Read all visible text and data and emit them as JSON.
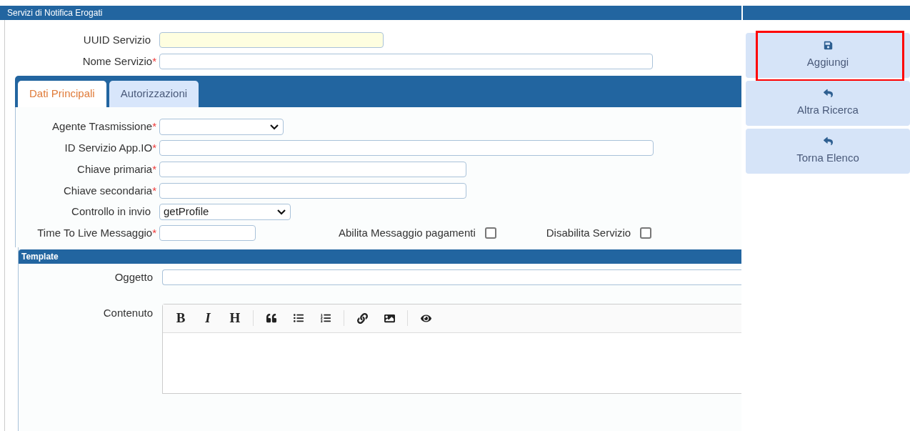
{
  "panel_title": "Servizi di Notifica Erogati",
  "top_fields": [
    {
      "label": "UUID Servizio",
      "kind": "readonly"
    },
    {
      "label": "Nome Servizio",
      "required_mark": "*",
      "kind": "text"
    }
  ],
  "tabs": [
    {
      "label": "Dati Principali",
      "selected": true
    },
    {
      "label": "Autorizzazioni",
      "selected": false
    }
  ],
  "tab_fields": [
    {
      "label": "Agente Trasmissione",
      "required_mark": "*",
      "kind": "select"
    },
    {
      "label": "ID Servizio App.IO",
      "required_mark": "*",
      "kind": "text"
    },
    {
      "label": "Chiave primaria",
      "required_mark": "*",
      "kind": "text"
    },
    {
      "label": "Chiave secondaria",
      "required_mark": "*",
      "kind": "text"
    },
    {
      "label": "Controllo in invio",
      "kind": "select",
      "value": "getProfile"
    },
    {
      "label": "Time To Live Messaggio",
      "required_mark": "*",
      "kind": "text"
    }
  ],
  "checkboxes": [
    {
      "label": "Abilita Messaggio pagamenti",
      "checked": false
    },
    {
      "label": "Disabilita Servizio",
      "checked": false
    }
  ],
  "template": {
    "title": "Template",
    "subject_label": "Oggetto",
    "content_label": "Contenuto",
    "toolbar_text": [
      {
        "label": "B",
        "italic": false
      },
      {
        "label": "I",
        "italic": true
      },
      {
        "label": "H",
        "italic": false
      }
    ]
  },
  "actions": [
    {
      "label": "Aggiungi",
      "highlighted": true
    },
    {
      "label": "Altra Ricerca",
      "highlighted": false
    },
    {
      "label": "Torna Elenco",
      "highlighted": false
    }
  ]
}
